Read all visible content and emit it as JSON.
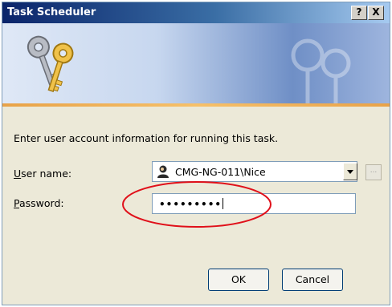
{
  "window": {
    "title": "Task Scheduler",
    "help_label": "?",
    "close_label": "X"
  },
  "dialog": {
    "prompt": "Enter user account information for running this task.",
    "user_label_accel": "U",
    "user_label_rest": "ser name:",
    "user_value": "CMG-NG-011\\Nice",
    "password_label_accel": "P",
    "password_label_rest": "assword:",
    "password_value": "•••••••••",
    "browse_label": "...",
    "ok_label": "OK",
    "cancel_label": "Cancel"
  },
  "icons": {
    "banner": "keys-icon",
    "user": "user-account-icon"
  },
  "colors": {
    "title_bar": "#0a246a",
    "dialog_bg": "#ece9d8",
    "banner_accent": "#e8a248",
    "annotation": "#e0101a"
  }
}
